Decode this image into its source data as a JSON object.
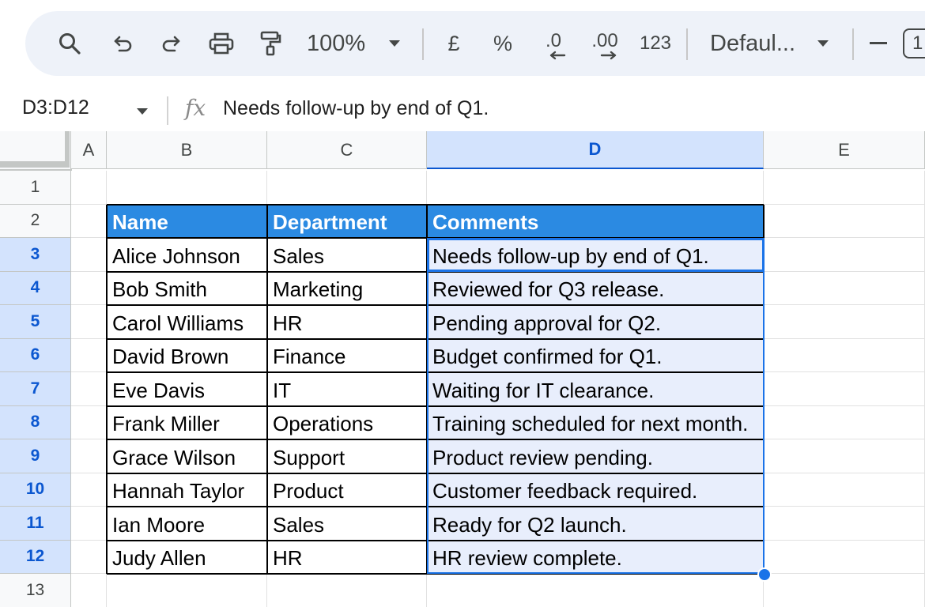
{
  "toolbar": {
    "zoom": "100%",
    "currency": "£",
    "percent": "%",
    "decrease_decimal": ".0",
    "increase_decimal": ".00",
    "number_format": "123",
    "font": "Defaul...",
    "minus": "−",
    "font_size_partial": "1"
  },
  "formula_bar": {
    "namebox": "D3:D12",
    "fx": "fx",
    "content": "Needs follow-up by end of Q1."
  },
  "columns": [
    "A",
    "B",
    "C",
    "D",
    "E"
  ],
  "rows": [
    "1",
    "2",
    "3",
    "4",
    "5",
    "6",
    "7",
    "8",
    "9",
    "10",
    "11",
    "12",
    "13"
  ],
  "table": {
    "headers": [
      "Name",
      "Department",
      "Comments"
    ],
    "rows": [
      [
        "Alice Johnson",
        "Sales",
        "Needs follow-up by end of Q1."
      ],
      [
        "Bob Smith",
        "Marketing",
        "Reviewed for Q3 release."
      ],
      [
        "Carol Williams",
        "HR",
        "Pending approval for Q2."
      ],
      [
        "David Brown",
        "Finance",
        "Budget confirmed for Q1."
      ],
      [
        "Eve Davis",
        "IT",
        "Waiting for IT clearance."
      ],
      [
        "Frank Miller",
        "Operations",
        "Training scheduled for next month."
      ],
      [
        "Grace Wilson",
        "Support",
        "Product review pending."
      ],
      [
        "Hannah Taylor",
        "Product",
        "Customer feedback required."
      ],
      [
        "Ian Moore",
        "Sales",
        "Ready for Q2 launch."
      ],
      [
        "Judy Allen",
        "HR",
        "HR review complete."
      ]
    ]
  },
  "colors": {
    "header_fill": "#2b8ae2",
    "selection_fill": "#e8eefc",
    "selection_border": "#1a73e8"
  }
}
